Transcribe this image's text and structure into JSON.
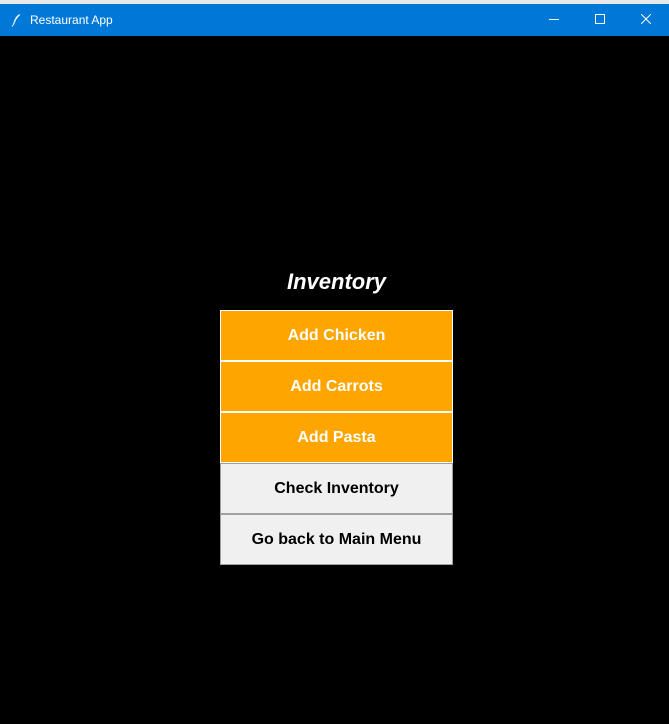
{
  "window": {
    "title": "Restaurant App",
    "titlebar_color": "#0078d7",
    "controls": {
      "minimize_icon": "minimize-icon",
      "maximize_icon": "maximize-icon",
      "close_icon": "close-icon"
    },
    "app_icon": "feather-icon"
  },
  "main": {
    "heading": "Inventory",
    "background_color": "#000000",
    "buttons": [
      {
        "label": "Add Chicken",
        "style": "orange",
        "color": "#ffa500"
      },
      {
        "label": "Add Carrots",
        "style": "orange",
        "color": "#ffa500"
      },
      {
        "label": "Add Pasta",
        "style": "orange",
        "color": "#ffa500"
      },
      {
        "label": "Check Inventory",
        "style": "light",
        "color": "#f0f0f0"
      },
      {
        "label": "Go back to Main Menu",
        "style": "light",
        "color": "#f0f0f0"
      }
    ]
  }
}
